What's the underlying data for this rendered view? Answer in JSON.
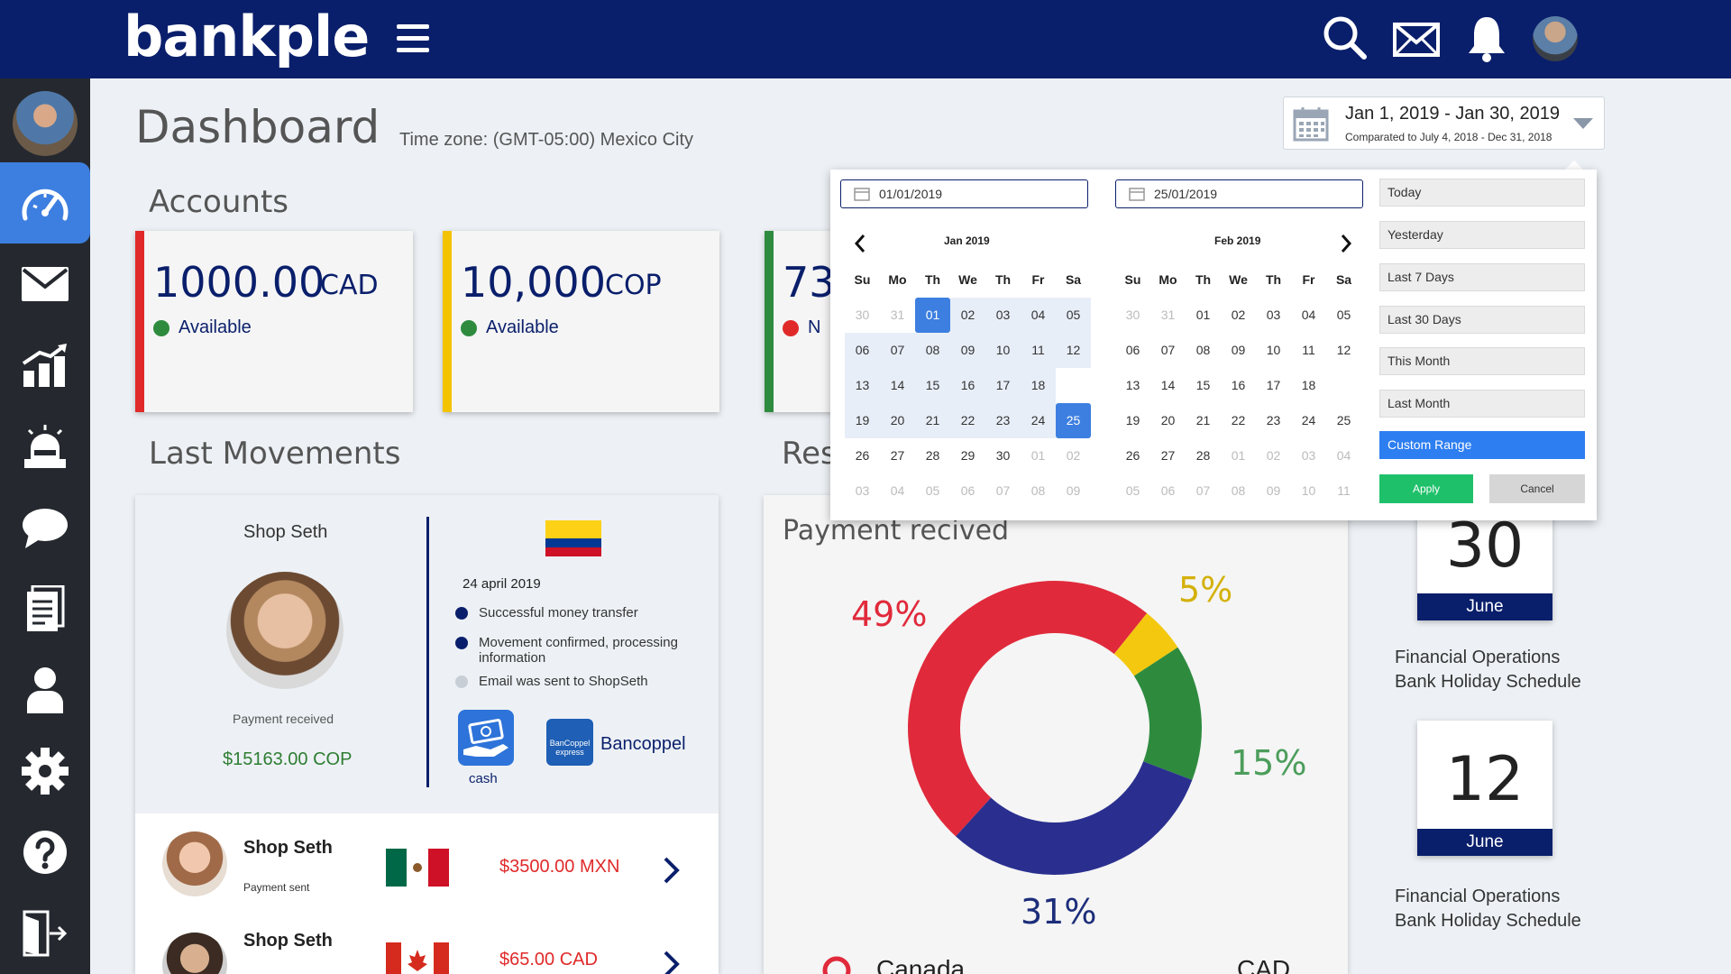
{
  "brand": {
    "name": "bankple",
    "primary": "#0a1f6b",
    "accent": "#3d7fe0"
  },
  "header": {
    "icons": [
      "menu-icon",
      "search-icon",
      "mail-icon",
      "bell-icon",
      "avatar"
    ]
  },
  "sidebar": {
    "items": [
      "dashboard-icon",
      "mail-icon",
      "chart-icon",
      "alarm-icon",
      "chat-icon",
      "document-icon",
      "user-icon",
      "settings-icon",
      "help-icon",
      "logout-icon"
    ],
    "active": "dashboard-icon"
  },
  "page": {
    "title": "Dashboard",
    "timezone": "Time zone: (GMT-05:00) Mexico City"
  },
  "date_range": {
    "label": "Jan 1, 2019 - Jan 30, 2019",
    "compare": "Comparated to July 4, 2018 - Dec 31, 2018",
    "start_input": "01/01/2019",
    "end_input": "25/01/2019",
    "left_month": "Jan 2019",
    "right_month": "Feb 2019",
    "weekdays": [
      "Su",
      "Mo",
      "Th",
      "We",
      "Th",
      "Fr",
      "Sa"
    ],
    "left_grid": [
      [
        "30",
        "31",
        "01",
        "02",
        "03",
        "04",
        "05"
      ],
      [
        "06",
        "07",
        "08",
        "09",
        "10",
        "11",
        "12"
      ],
      [
        "13",
        "14",
        "15",
        "16",
        "17",
        "18"
      ],
      [
        "19",
        "20",
        "21",
        "22",
        "23",
        "24",
        "25"
      ],
      [
        "26",
        "27",
        "28",
        "29",
        "30",
        "01",
        "02"
      ],
      [
        "03",
        "04",
        "05",
        "06",
        "07",
        "08",
        "09"
      ]
    ],
    "right_grid": [
      [
        "30",
        "31",
        "01",
        "02",
        "03",
        "04",
        "05"
      ],
      [
        "06",
        "07",
        "08",
        "09",
        "10",
        "11",
        "12"
      ],
      [
        "13",
        "14",
        "15",
        "16",
        "17",
        "18"
      ],
      [
        "19",
        "20",
        "21",
        "22",
        "23",
        "24",
        "25"
      ],
      [
        "26",
        "27",
        "28",
        "01",
        "02",
        "03",
        "04"
      ],
      [
        "05",
        "06",
        "07",
        "08",
        "09",
        "10",
        "11"
      ]
    ],
    "presets": [
      "Today",
      "Yesterday",
      "Last 7 Days",
      "Last 30 Days",
      "This Month",
      "Last Month",
      "Custom Range"
    ],
    "active_preset": "Custom Range",
    "apply": "Apply",
    "cancel": "Cancel"
  },
  "accounts": {
    "title": "Accounts",
    "cards": [
      {
        "amount": "1000.00",
        "currency": "CAD",
        "status": "Available",
        "bar_color": "#e02a2a",
        "dot_color": "#2e8b3e"
      },
      {
        "amount": "10,000",
        "currency": "COP",
        "status": "Available",
        "bar_color": "#f3c300",
        "dot_color": "#2e8b3e"
      },
      {
        "amount": "73",
        "currency": "",
        "status": "N",
        "bar_color": "#2e8b3e",
        "dot_color": "#e02a2a"
      }
    ]
  },
  "movements": {
    "title": "Last Movements",
    "featured": {
      "name": "Shop Seth",
      "caption": "Payment received",
      "amount": "$15163.00 COP",
      "date": "24 april 2019",
      "timeline": [
        {
          "text": "Successful money transfer",
          "state": "done"
        },
        {
          "text": "Movement confirmed, processing information",
          "state": "done"
        },
        {
          "text": "Email was sent to ShopSeth",
          "state": "pending"
        }
      ],
      "cash_label": "cash",
      "bank_label": "Bancoppel",
      "bank_badge": "BanCoppel express"
    },
    "rows": [
      {
        "name": "Shop Seth",
        "sub": "Payment sent",
        "amount": "$3500.00 MXN",
        "flag": "mexico"
      },
      {
        "name": "Shop Seth",
        "sub": "",
        "amount": "$65.00 CAD",
        "flag": "canada"
      }
    ]
  },
  "second_section": {
    "title": "Res"
  },
  "payment": {
    "title": "Payment recived",
    "bottom_left": "Canada",
    "bottom_right": "CAD",
    "labels": [
      "49%",
      "5%",
      "15%",
      "31%"
    ]
  },
  "chart_data": {
    "type": "pie",
    "title": "Payment recived",
    "categories": [
      "",
      "",
      "",
      ""
    ],
    "values": [
      49,
      5,
      15,
      31
    ],
    "colors": [
      "#e02a3b",
      "#f3c80f",
      "#2e8b3e",
      "#2a2f8f"
    ]
  },
  "calendars": [
    {
      "day": "30",
      "month": "June",
      "text": [
        "Financial Operations",
        "Bank Holiday Schedule"
      ]
    },
    {
      "day": "12",
      "month": "June",
      "text": [
        "Financial Operations",
        "Bank Holiday Schedule"
      ]
    }
  ]
}
